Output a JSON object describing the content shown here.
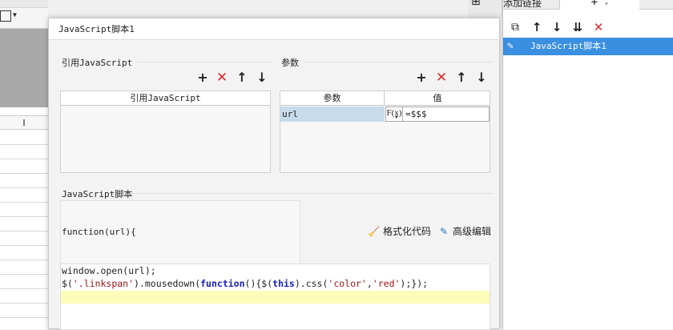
{
  "background": {
    "column_header": "I"
  },
  "right_panel": {
    "title": "添加链接",
    "add_symbol": "+",
    "add_caret": "▾",
    "toolbar": [
      {
        "name": "copy-icon",
        "glyph": "⧉"
      },
      {
        "name": "arrow-up-icon",
        "glyph": "↑"
      },
      {
        "name": "arrow-down-icon",
        "glyph": "↓"
      },
      {
        "name": "sort-down-icon",
        "glyph": "⇊"
      },
      {
        "name": "delete-icon",
        "glyph": "✕"
      }
    ],
    "items": [
      {
        "label": "JavaScript脚本1",
        "selected": true
      }
    ]
  },
  "dialog": {
    "title": "JavaScript脚本1",
    "ref_section": {
      "label": "引用JavaScript",
      "column_header": "引用JavaScript"
    },
    "param_section": {
      "label": "参数",
      "columns": [
        "参数",
        "值"
      ],
      "rows": [
        {
          "name": "url",
          "fx_label": "F(x)",
          "value": "=$$$"
        }
      ]
    },
    "script_section": {
      "label": "JavaScript脚本",
      "signature": "function(url){",
      "format_button": "格式化代码",
      "advanced_button": "高级编辑",
      "code_lines": [
        "window.open(url);",
        "$('.linkspan').mousedown(function(){$(this).css('color','red');});"
      ]
    }
  },
  "colors": {
    "selection_blue": "#3b8fe0",
    "param_row_highlight": "#c7dbeb",
    "delete_red": "#e02a2a",
    "current_line": "#fefcb8",
    "keyword_blue": "#1a20c0",
    "string_red": "#a31515"
  }
}
